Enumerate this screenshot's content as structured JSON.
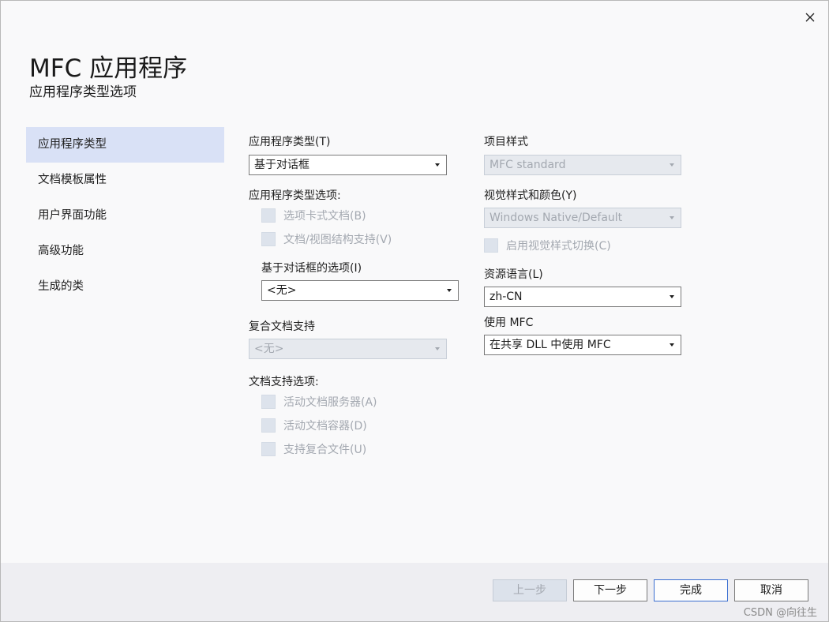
{
  "window": {
    "title": "MFC 应用程序",
    "subtitle": "应用程序类型选项"
  },
  "nav": {
    "items": [
      {
        "label": "应用程序类型",
        "selected": true
      },
      {
        "label": "文档模板属性",
        "selected": false
      },
      {
        "label": "用户界面功能",
        "selected": false
      },
      {
        "label": "高级功能",
        "selected": false
      },
      {
        "label": "生成的类",
        "selected": false
      }
    ]
  },
  "left": {
    "app_type_label": "应用程序类型(T)",
    "app_type_value": "基于对话框",
    "app_type_options_label": "应用程序类型选项:",
    "tabbed_docs_label": "选项卡式文档(B)",
    "doc_view_label": "文档/视图结构支持(V)",
    "dialog_options_label": "基于对话框的选项(I)",
    "dialog_options_value": "<无>",
    "compound_label": "复合文档支持",
    "compound_value": "<无>",
    "doc_support_label": "文档支持选项:",
    "active_server_label": "活动文档服务器(A)",
    "active_container_label": "活动文档容器(D)",
    "compound_files_label": "支持复合文件(U)"
  },
  "right": {
    "project_style_label": "项目样式",
    "project_style_value": "MFC standard",
    "visual_style_label": "视觉样式和颜色(Y)",
    "visual_style_value": "Windows Native/Default",
    "visual_switch_label": "启用视觉样式切换(C)",
    "resource_lang_label": "资源语言(L)",
    "resource_lang_value": "zh-CN",
    "use_mfc_label": "使用 MFC",
    "use_mfc_value": "在共享 DLL 中使用 MFC"
  },
  "footer": {
    "prev_label": "上一步",
    "next_label": "下一步",
    "finish_label": "完成",
    "cancel_label": "取消"
  },
  "watermark": "CSDN @向往生",
  "colors": {
    "selected_nav_bg": "#d9e1f6",
    "disabled_fill": "#dde3ec",
    "primary_border": "#3b6fd1"
  }
}
